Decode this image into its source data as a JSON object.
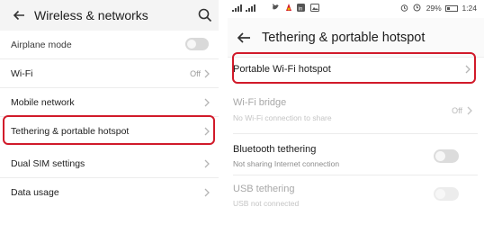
{
  "left": {
    "header": {
      "title": "Wireless & networks",
      "back_icon": "arrow-left-icon",
      "search_icon": "search-icon"
    },
    "items": [
      {
        "label": "Airplane mode",
        "control": "toggle",
        "state": "off"
      },
      {
        "label": "Wi-Fi",
        "value": "Off"
      },
      {
        "label": "Mobile network"
      },
      {
        "label": "Tethering & portable hotspot",
        "highlighted": true
      },
      {
        "label": "Dual SIM settings"
      },
      {
        "label": "Data usage"
      }
    ]
  },
  "right": {
    "statusbar": {
      "left": "⁴ᴳₗₗₗ ᴴᴳₗₗₗ",
      "battery_percent": "29%",
      "time": "1:24"
    },
    "header": {
      "title": "Tethering & portable hotspot",
      "back_icon": "arrow-left-icon"
    },
    "items": [
      {
        "title": "Portable Wi-Fi hotspot",
        "highlighted": true
      },
      {
        "title": "Wi-Fi bridge",
        "subtitle": "No Wi-Fi connection to share",
        "value": "Off",
        "disabled": true
      },
      {
        "title": "Bluetooth tethering",
        "subtitle": "Not sharing Internet connection",
        "control": "toggle",
        "state": "off"
      },
      {
        "title": "USB tethering",
        "subtitle": "USB not connected",
        "control": "toggle",
        "state": "off",
        "disabled": true
      }
    ]
  },
  "colors": {
    "highlight": "#d11a2a",
    "text": "#1d1d1d",
    "muted": "#9a9a9a"
  }
}
